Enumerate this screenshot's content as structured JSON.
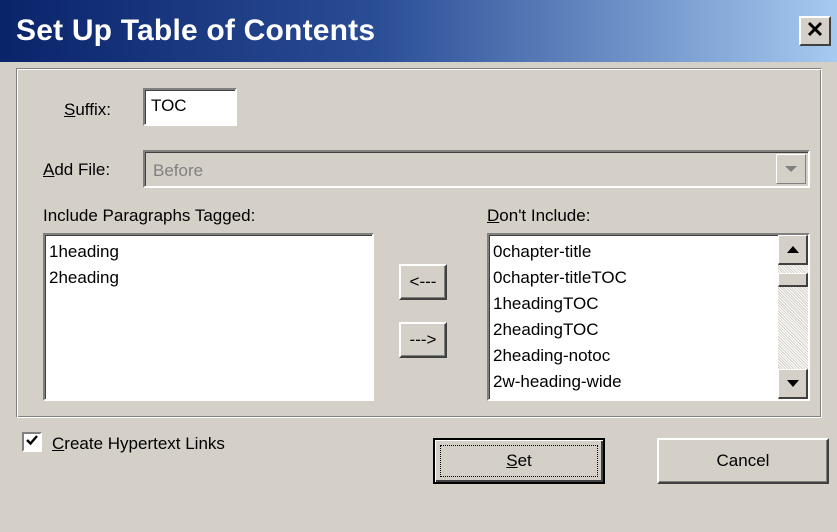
{
  "window": {
    "title": "Set Up Table of Contents",
    "close_label": "✕"
  },
  "suffix": {
    "label": "Suffix:",
    "mnemonic": "S",
    "label_rest": "uffix:",
    "value": "TOC"
  },
  "add_file": {
    "mnemonic": "A",
    "label_rest": "dd File:",
    "selected": "Before",
    "disabled": true
  },
  "include": {
    "label": "Include Paragraphs Tagged:",
    "items": [
      "1heading",
      "2heading"
    ]
  },
  "exclude": {
    "mnemonic": "D",
    "label_rest": "on't Include:",
    "items": [
      "0chapter-title",
      "0chapter-titleTOC",
      "1headingTOC",
      "2headingTOC",
      "2heading-notoc",
      "2w-heading-wide"
    ]
  },
  "move": {
    "left_label": "<---",
    "right_label": "--->"
  },
  "hypertext": {
    "mnemonic": "C",
    "label_rest": "reate Hypertext Links",
    "checked": true,
    "check_glyph": "✔"
  },
  "buttons": {
    "set_mnemonic": "S",
    "set_rest": "et",
    "cancel": "Cancel"
  },
  "icons": {
    "close": "close-icon",
    "dropdown": "chevron-down-icon",
    "scroll_up": "scroll-up-icon",
    "scroll_down": "scroll-down-icon",
    "check": "checkmark-icon"
  }
}
